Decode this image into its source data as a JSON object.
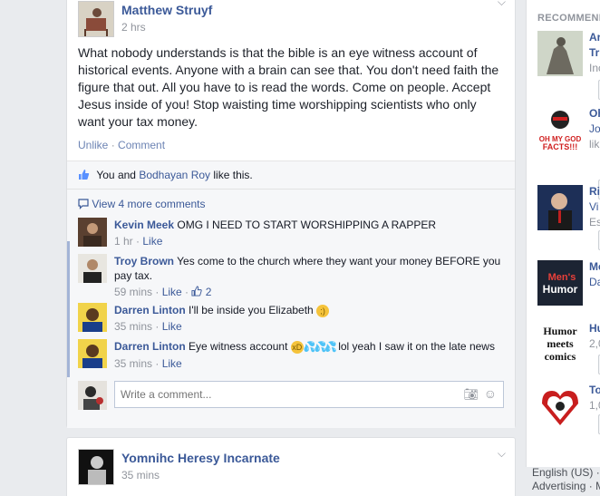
{
  "post": {
    "author": "Matthew Struyf",
    "time": "2 hrs",
    "body": "What nobody understands is that the bible is an eye witness account of historical events. Anyone with a brain can see that. You don't need faith the figure that out. All you have to is read the words. Come on people. Accept Jesus inside of you! Stop waisting time worshipping scientists who only want your tax money.",
    "actions": {
      "unlike": "Unlike",
      "separator": "·",
      "comment": "Comment"
    },
    "likes": {
      "you": "You",
      "and": "and",
      "other": "Bodhayan Roy",
      "suffix": "like this."
    },
    "view_more": "View 4 more comments",
    "comments": [
      {
        "author": "Kevin Meek",
        "text": "OMG I NEED TO START WORSHIPPING A RAPPER",
        "time": "1 hr",
        "like": "Like"
      },
      {
        "author": "Troy Brown",
        "text": "Yes come to the church where they want your money BEFORE you pay tax.",
        "time": "59 mins",
        "like": "Like",
        "like_count": "2"
      },
      {
        "author": "Darren Linton",
        "text": "I'll be inside you Elizabeth",
        "time": "35 mins",
        "like": "Like"
      },
      {
        "author": "Darren Linton",
        "text_before": "Eye witness account",
        "text_after": "lol yeah I saw it on the late news",
        "time": "35 mins",
        "like": "Like"
      }
    ],
    "write_placeholder": "Write a comment..."
  },
  "post2": {
    "author": "Yomnihc Heresy Incarnate",
    "time": "35 mins"
  },
  "rail": {
    "title": "RECOMMEND",
    "items": [
      {
        "name": "Ar",
        "line2": "Tr",
        "line3": "Inc"
      },
      {
        "name": "Oh",
        "line2": "Jo",
        "line3": "lik",
        "image_text": "OH MY GOD FACTS!!!"
      },
      {
        "name": "Ri",
        "line2": "Vi",
        "line3": "Es"
      },
      {
        "name": "Me",
        "line2": "Da",
        "image_text_1": "Men's",
        "image_text_2": "Humor"
      },
      {
        "name": "Hu",
        "line2": "2,0",
        "image_text_1": "Humor",
        "image_text_2": "meets",
        "image_text_3": "comics"
      },
      {
        "name": "To",
        "line2": "1,0"
      }
    ]
  },
  "footer": {
    "language": "English (US)",
    "separator": "·",
    "advertising": "Advertising",
    "more": "M"
  },
  "colors": {
    "link": "#3b5998",
    "meta": "#90949c",
    "background": "#e9ebee",
    "thumb": "#5890ff"
  }
}
